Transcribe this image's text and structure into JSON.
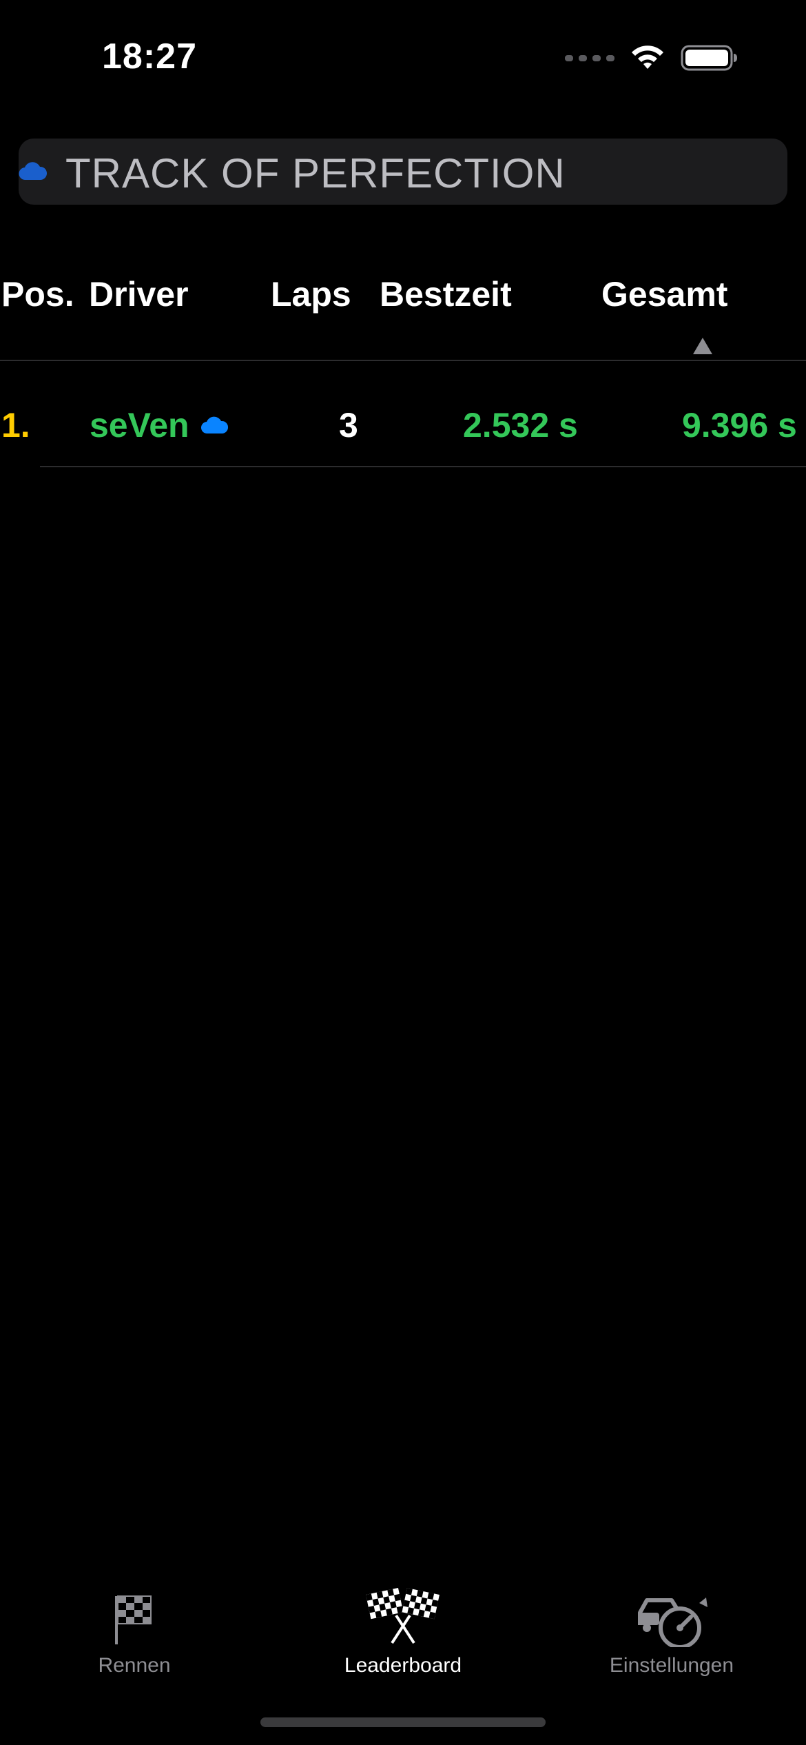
{
  "status_bar": {
    "time": "18:27"
  },
  "title_bar": {
    "title": "TRACK OF PERFECTION",
    "icon": "cloud-icon"
  },
  "table": {
    "headers": {
      "pos": "Pos.",
      "driver": "Driver",
      "laps": "Laps",
      "best": "Bestzeit",
      "total": "Gesamt"
    },
    "sort": {
      "column": "total",
      "direction": "ascending",
      "icon": "triangle-up-icon"
    },
    "rows": [
      {
        "pos": "1.",
        "driver": "seVen",
        "driver_icon": "cloud-icon",
        "laps": "3",
        "best": "2.532 s",
        "total": "9.396 s"
      }
    ]
  },
  "tab_bar": {
    "tabs": [
      {
        "label": "Rennen",
        "icon": "checkered-flag-icon",
        "active": false
      },
      {
        "label": "Leaderboard",
        "icon": "crossed-flags-icon",
        "active": true
      },
      {
        "label": "Einstellungen",
        "icon": "car-speedometer-icon",
        "active": false
      }
    ]
  },
  "colors": {
    "background": "#000000",
    "title_bar_bg": "#1c1c1e",
    "position": "#ffcc00",
    "highlight": "#34c759",
    "icon_blue": "#0a84ff",
    "inactive": "#8e8e93"
  }
}
